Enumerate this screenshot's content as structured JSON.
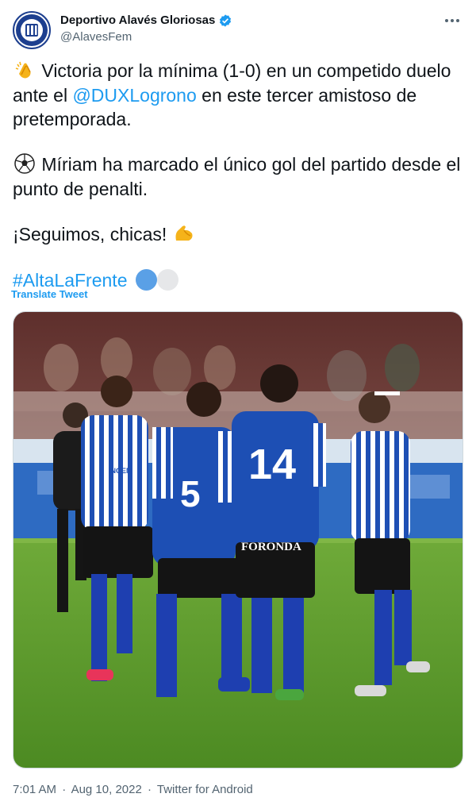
{
  "author": {
    "display_name": "Deportivo Alavés Gloriosas",
    "handle": "@AlavesFem",
    "avatar_icon": "deportivo-alaves-crest-icon",
    "verified_icon": "verified-badge-icon",
    "more_icon": "more-dots-icon"
  },
  "tweet": {
    "p1_pre": " Victoria por la mínima (1-0) en un competido duelo ante el ",
    "p1_mention": "@DUXLogrono",
    "p1_post": " en este tercer amistoso de pretemporada.",
    "p2": " Míriam ha marcado el único gol del partido desde el punto de penalti.",
    "p3": "¡Seguimos, chicas! ",
    "hashtag": "#AltaLaFrente",
    "emoji_1": "clapping-hands-icon",
    "emoji_2": "soccer-ball-icon",
    "emoji_3": "flexed-biceps-icon"
  },
  "translate_label": "Translate Tweet",
  "meta": {
    "time": "7:01 AM",
    "sep1": "·",
    "date": "Aug 10, 2022",
    "sep2": "·",
    "source": "Twitter for Android"
  },
  "colors": {
    "link": "#1d9bf0",
    "muted": "#536471",
    "alaves_blue": "#1d4fb0"
  },
  "photo": {
    "players_numbers": [
      "5",
      "14"
    ],
    "sponsors": [
      "INGEM",
      "FORONDA"
    ]
  }
}
